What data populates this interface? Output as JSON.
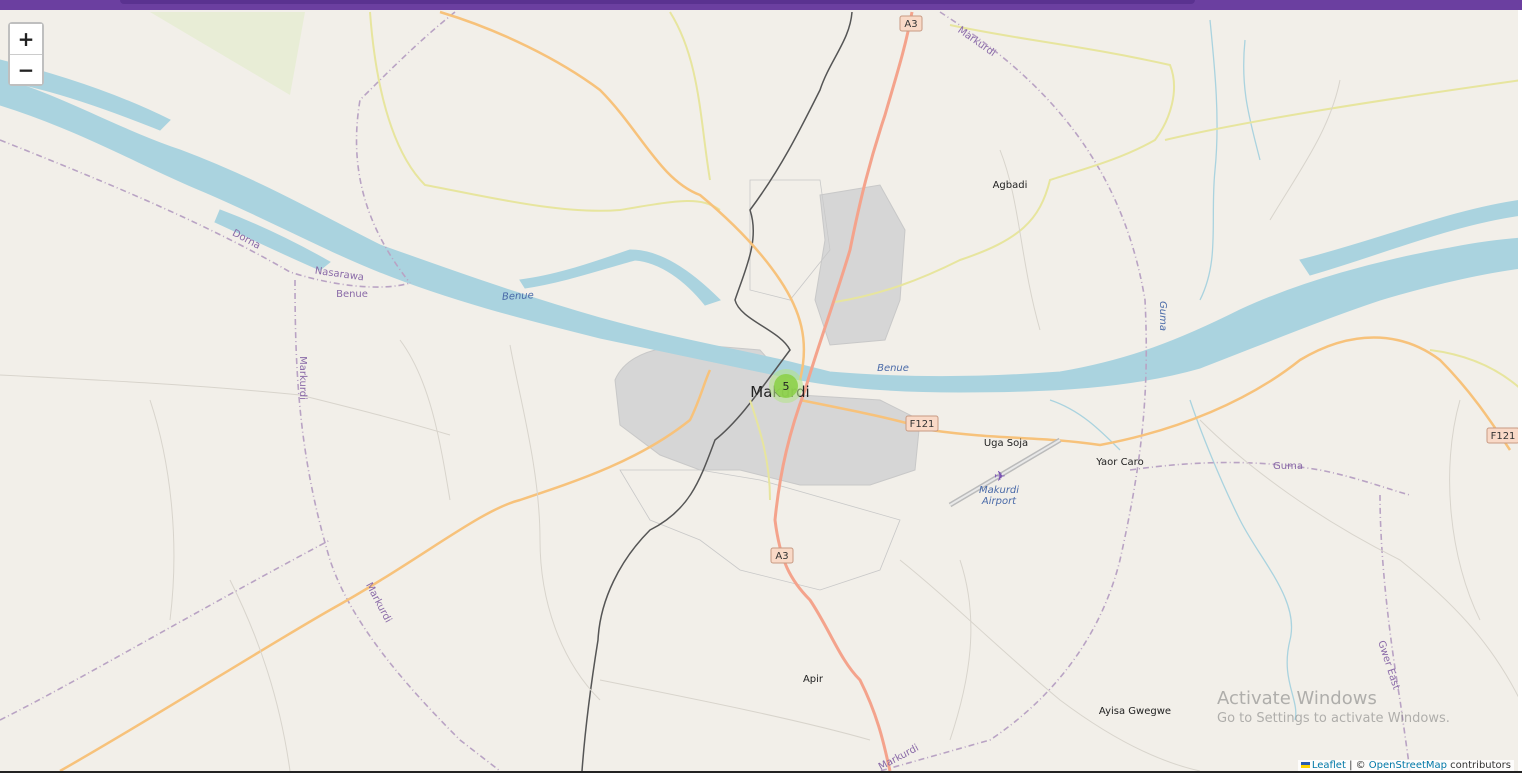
{
  "map": {
    "zoom_in_label": "+",
    "zoom_out_label": "−",
    "places": {
      "city": "Makurdi",
      "agbadi": "Agbadi",
      "uga_soja": "Uga Soja",
      "yaor_caro": "Yaor Caro",
      "apir": "Apir",
      "ayisa_gwegwe": "Ayisa Gwegwe",
      "airport_line1": "Makurdi",
      "airport_line2": "Airport"
    },
    "water": {
      "benue_west": "Benue",
      "benue_center": "Benue",
      "guma_river": "Guma",
      "guma_east": "Guma",
      "dorna": "Dorna",
      "benue_boundary": "Benue"
    },
    "boundaries": {
      "nasarawa": "Nasarawa",
      "markurdi_north": "Markurdi",
      "markurdi_west": "Markurdi",
      "markurdi_sw": "Markurdi",
      "markurdi_south": "Markurdi",
      "gwer_east": "Gwer East"
    },
    "road_shields": {
      "a3_north": "A3",
      "a3_south": "A3",
      "f121_center": "F121",
      "f121_east": "F121"
    },
    "cluster": {
      "count": "5",
      "color": "#8dd04a"
    },
    "colors": {
      "background": "#f2efe9",
      "water": "#aad3df",
      "trunk_road": "#f4a38c",
      "primary_road": "#f7c27b",
      "secondary_road": "#f6f59a",
      "urban": "#d9d9d9",
      "boundary": "#b9a3c4",
      "accent_bar": "#6b3fa0"
    }
  },
  "attribution": {
    "leaflet": "Leaflet",
    "separator": " | © ",
    "osm": "OpenStreetMap",
    "contributors": " contributors"
  },
  "watermark": {
    "line1": "Activate Windows",
    "line2": "Go to Settings to activate Windows."
  }
}
